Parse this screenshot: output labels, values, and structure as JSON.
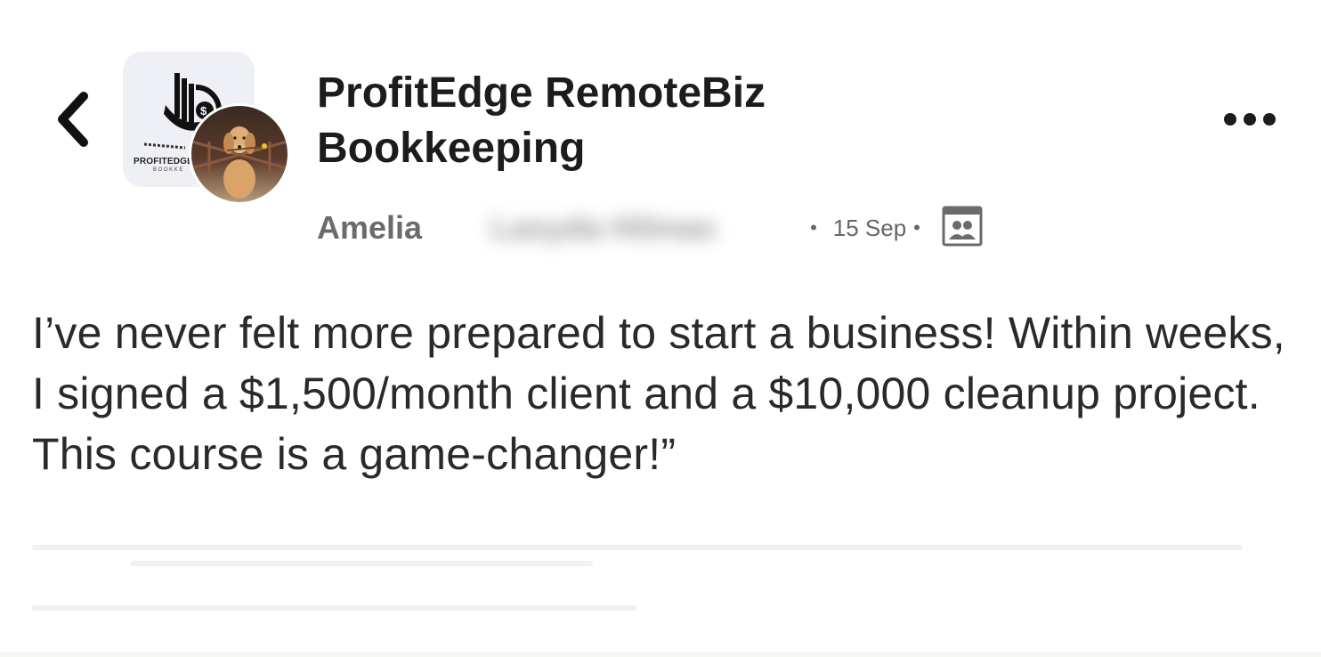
{
  "header": {
    "group_name": "ProfitEdge RemoteBiz Bookkeeping",
    "group_logo_text": "PROFITEDGE",
    "group_logo_subtext": "BOOKKE",
    "icons": {
      "back": "chevron-left-icon",
      "more": "more-horizontal-icon",
      "audience": "group-audience-icon"
    }
  },
  "post": {
    "author": "Amelia",
    "author_blurred": "Lasyda Hilmas",
    "date": "15 Sep",
    "separator": "•",
    "text": "I’ve never felt more prepared to start a business! Within weeks, I signed a $1,500/month client and a $10,000 cleanup project. This course is a game-changer!”"
  },
  "colors": {
    "text_primary": "#1c1c1c",
    "text_secondary": "#6b6b6b",
    "avatar_bg": "#eef0f5",
    "background": "#ffffff"
  }
}
